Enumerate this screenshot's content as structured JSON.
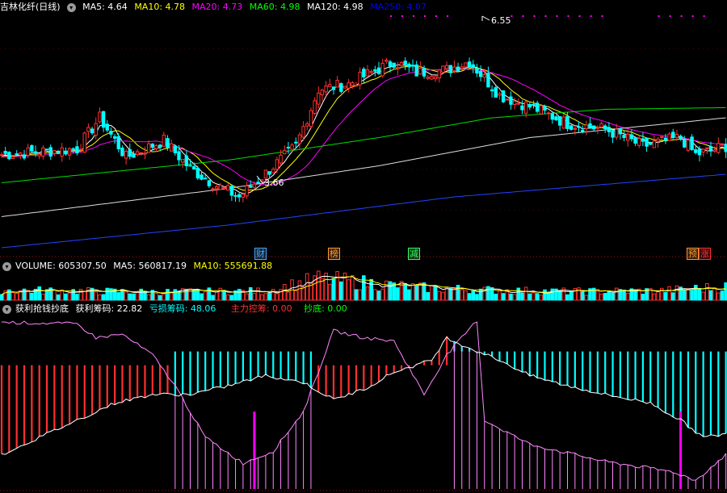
{
  "price_header": {
    "title": "吉林化纤(日线)",
    "items": [
      {
        "label": "MA5: 4.64",
        "color": "#ffffff"
      },
      {
        "label": "MA10: 4.78",
        "color": "#ffff00"
      },
      {
        "label": "MA20: 4.73",
        "color": "#ff00ff"
      },
      {
        "label": "MA60: 4.98",
        "color": "#00ff00"
      },
      {
        "label": "MA120: 4.98",
        "color": "#ffffff"
      },
      {
        "label": "MA250: 4.07",
        "color": "#0000ff"
      }
    ]
  },
  "volume_header": {
    "items": [
      {
        "label": "VOLUME: 605307.50",
        "color": "#ffffff"
      },
      {
        "label": "MA5: 560817.19",
        "color": "#ffffff"
      },
      {
        "label": "MA10: 555691.88",
        "color": "#ffff00"
      }
    ]
  },
  "indicator_header": {
    "items": [
      {
        "label": "获利抢钱抄底",
        "color": "#ffffff"
      },
      {
        "label": "获利筹码: 22.82",
        "color": "#ffffff"
      },
      {
        "label": "亏损筹码: 48.06",
        "color": "#00ffff"
      },
      {
        "label": "主力控筹: 0.00",
        "color": "#ff3030"
      },
      {
        "label": "抄底: 0.00",
        "color": "#00ff00"
      }
    ]
  },
  "price_annotations": {
    "high": "6.55",
    "low": "3.66"
  },
  "event_badges": [
    {
      "label": "财",
      "color": "#4aa8ff"
    },
    {
      "label": "榜",
      "color": "#ff9a33"
    },
    {
      "label": "减",
      "color": "#33ff66"
    },
    {
      "label": "预",
      "color": "#ff9a33"
    },
    {
      "label": "涨",
      "color": "#ff3030"
    }
  ],
  "colors": {
    "up": "#ff3030",
    "down": "#00ffff",
    "pink": "#ff88ff",
    "magenta": "#ff00ff"
  },
  "chart_data": [
    {
      "type": "candlestick",
      "name": "price",
      "ylim": [
        3.0,
        7.0
      ],
      "anchors_close": [
        [
          0,
          4.55
        ],
        [
          10,
          4.6
        ],
        [
          20,
          4.65
        ],
        [
          26,
          5.2
        ],
        [
          33,
          4.5
        ],
        [
          43,
          4.8
        ],
        [
          50,
          4.3
        ],
        [
          57,
          4.0
        ],
        [
          63,
          3.8
        ],
        [
          68,
          4.1
        ],
        [
          78,
          4.7
        ],
        [
          84,
          5.7
        ],
        [
          92,
          5.8
        ],
        [
          98,
          6.0
        ],
        [
          104,
          6.2
        ],
        [
          110,
          6.0
        ],
        [
          118,
          6.05
        ],
        [
          124,
          6.2
        ],
        [
          132,
          5.6
        ],
        [
          142,
          5.35
        ],
        [
          150,
          5.1
        ],
        [
          160,
          5.0
        ],
        [
          170,
          4.7
        ],
        [
          180,
          4.85
        ],
        [
          184,
          4.55
        ],
        [
          192,
          4.7
        ]
      ],
      "annotations": [
        {
          "label": "6.55",
          "value": 6.55
        },
        {
          "label": "3.66",
          "value": 3.66
        }
      ]
    },
    {
      "type": "bar",
      "name": "volume",
      "ylim": [
        0,
        1300000
      ],
      "anchors": [
        [
          0,
          450000
        ],
        [
          40,
          360000
        ],
        [
          70,
          400000
        ],
        [
          84,
          950000
        ],
        [
          92,
          850000
        ],
        [
          110,
          560000
        ],
        [
          130,
          440000
        ],
        [
          150,
          380000
        ],
        [
          175,
          420000
        ],
        [
          192,
          600000
        ]
      ]
    },
    {
      "type": "bar",
      "name": "indicator",
      "ylim": [
        0,
        100
      ],
      "profit_anchors": [
        [
          0,
          97
        ],
        [
          20,
          96
        ],
        [
          25,
          88
        ],
        [
          32,
          90
        ],
        [
          40,
          78
        ],
        [
          46,
          60
        ],
        [
          54,
          30
        ],
        [
          64,
          15
        ],
        [
          72,
          22
        ],
        [
          80,
          45
        ],
        [
          88,
          92
        ],
        [
          96,
          88
        ],
        [
          104,
          86
        ],
        [
          112,
          55
        ],
        [
          118,
          78
        ],
        [
          126,
          98
        ],
        [
          128,
          40
        ],
        [
          140,
          26
        ],
        [
          160,
          16
        ],
        [
          178,
          10
        ],
        [
          184,
          5
        ],
        [
          192,
          20
        ]
      ],
      "loss_anchors": [
        [
          0,
          20
        ],
        [
          20,
          40
        ],
        [
          30,
          50
        ],
        [
          40,
          55
        ],
        [
          50,
          55
        ],
        [
          60,
          60
        ],
        [
          70,
          66
        ],
        [
          80,
          62
        ],
        [
          88,
          52
        ],
        [
          96,
          58
        ],
        [
          104,
          68
        ],
        [
          114,
          75
        ],
        [
          118,
          88
        ],
        [
          124,
          82
        ],
        [
          132,
          75
        ],
        [
          140,
          66
        ],
        [
          150,
          60
        ],
        [
          160,
          55
        ],
        [
          172,
          50
        ],
        [
          180,
          40
        ],
        [
          186,
          30
        ],
        [
          192,
          32
        ]
      ],
      "zones": [
        [
          0,
          45,
          "red"
        ],
        [
          46,
          82,
          "cyan"
        ],
        [
          83,
          118,
          "red"
        ],
        [
          119,
          192,
          "cyan"
        ]
      ],
      "marker_indices": [
        67,
        180
      ]
    }
  ]
}
